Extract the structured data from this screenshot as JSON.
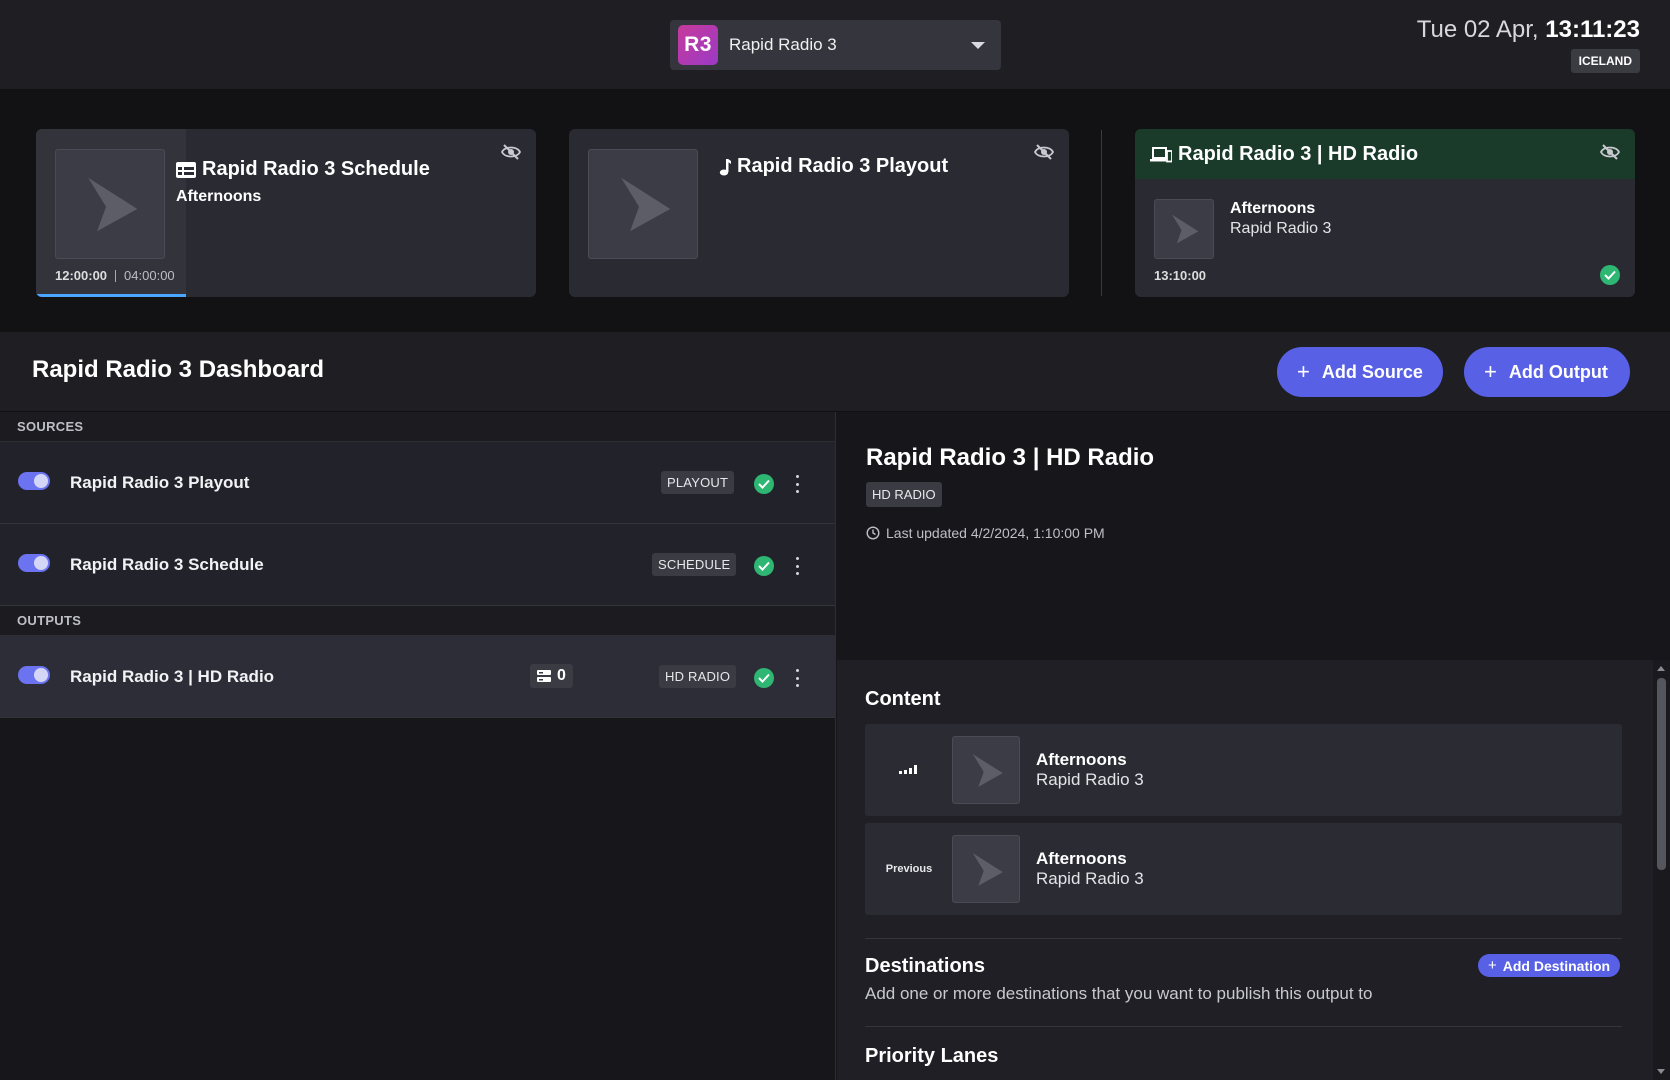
{
  "topbar": {
    "station_badge": "R3",
    "station_name": "Rapid Radio 3",
    "date": "Tue 02 Apr,",
    "time": "13:11:23",
    "region": "ICELAND"
  },
  "cards": {
    "schedule": {
      "title": "Rapid Radio 3 Schedule",
      "subtitle": "Afternoons",
      "start_time": "12:00:00",
      "duration": "04:00:00",
      "progress_fraction": 0.3
    },
    "playout": {
      "title": "Rapid Radio 3 Playout"
    },
    "hd": {
      "title": "Rapid Radio 3 | HD Radio",
      "line1": "Afternoons",
      "line2": "Rapid Radio 3",
      "time": "13:10:00"
    }
  },
  "dashboard": {
    "title": "Rapid Radio 3 Dashboard",
    "add_source": "Add Source",
    "add_output": "Add Output"
  },
  "sources": {
    "label": "SOURCES",
    "items": [
      {
        "name": "Rapid Radio 3 Playout",
        "tag": "PLAYOUT"
      },
      {
        "name": "Rapid Radio 3 Schedule",
        "tag": "SCHEDULE"
      }
    ]
  },
  "outputs": {
    "label": "OUTPUTS",
    "items": [
      {
        "name": "Rapid Radio 3 | HD Radio",
        "tag": "HD RADIO",
        "destinations": "0"
      }
    ]
  },
  "detail": {
    "title": "Rapid Radio 3 | HD Radio",
    "tag": "HD RADIO",
    "updated": "Last updated 4/2/2024, 1:10:00 PM",
    "content_heading": "Content",
    "content": [
      {
        "label": "",
        "line1": "Afternoons",
        "line2": "Rapid Radio 3"
      },
      {
        "label": "Previous",
        "line1": "Afternoons",
        "line2": "Rapid Radio 3"
      }
    ],
    "destinations_heading": "Destinations",
    "destinations_desc": "Add one or more destinations that you want to publish this output to",
    "add_destination": "Add Destination",
    "priority_heading": "Priority Lanes"
  },
  "colors": {
    "accent": "#5861e6",
    "ok": "#2eb673",
    "hd_header": "#1a3a2a",
    "progress": "#4aa6ff"
  }
}
